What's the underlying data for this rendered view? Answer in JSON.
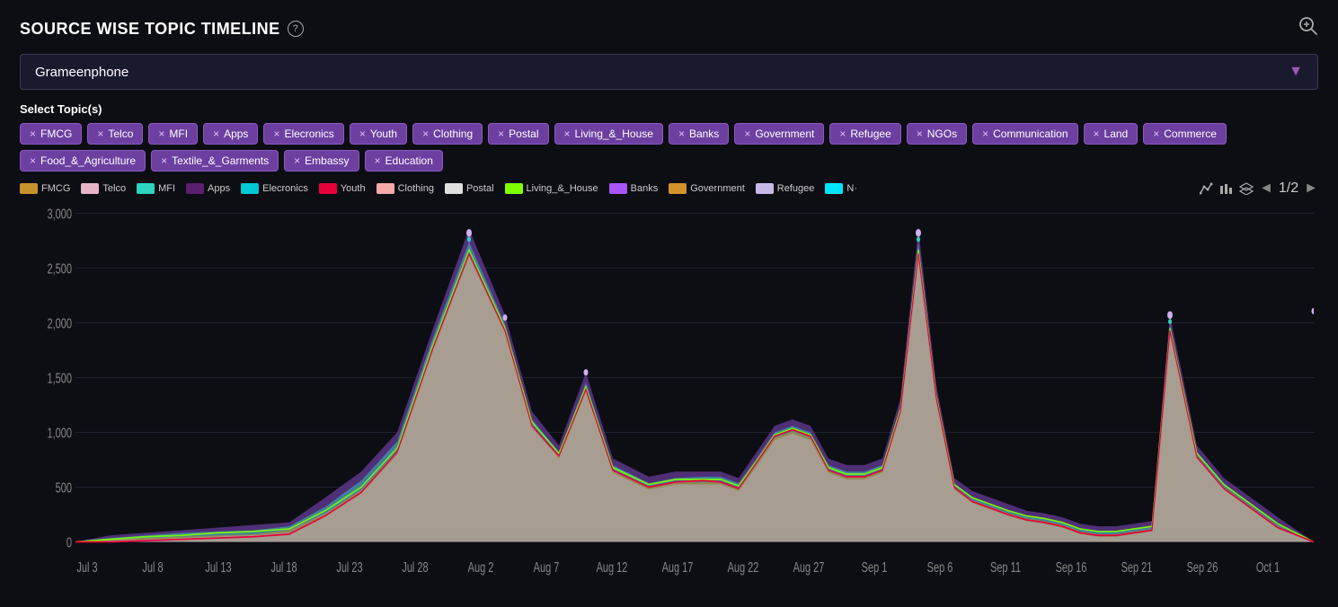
{
  "header": {
    "title": "SOURCE WISE TOPIC TIMELINE",
    "info_icon": "ⓘ",
    "zoom_icon": "⊕"
  },
  "dropdown": {
    "selected": "Grameenphone",
    "arrow": "▼"
  },
  "select_label": "Select Topic(s)",
  "topics_row1": [
    {
      "label": "FMCG"
    },
    {
      "label": "Telco"
    },
    {
      "label": "MFI"
    },
    {
      "label": "Apps"
    },
    {
      "label": "Elecronics"
    },
    {
      "label": "Youth"
    },
    {
      "label": "Clothing"
    },
    {
      "label": "Postal"
    },
    {
      "label": "Living_&_House"
    },
    {
      "label": "Banks"
    },
    {
      "label": "Government"
    },
    {
      "label": "Refugee"
    },
    {
      "label": "NGOs"
    }
  ],
  "topics_row2": [
    {
      "label": "Communication"
    },
    {
      "label": "Land"
    },
    {
      "label": "Commerce"
    },
    {
      "label": "Food_&_Agriculture"
    },
    {
      "label": "Textile_&_Garments"
    },
    {
      "label": "Embassy"
    },
    {
      "label": "Education"
    }
  ],
  "legend": {
    "items": [
      {
        "label": "FMCG",
        "color": "#c8922a"
      },
      {
        "label": "Telco",
        "color": "#e8b4c8"
      },
      {
        "label": "MFI",
        "color": "#2dd4bf"
      },
      {
        "label": "Apps",
        "color": "#5a1f6e"
      },
      {
        "label": "Elecronics",
        "color": "#00c8d4"
      },
      {
        "label": "Youth",
        "color": "#e8003a"
      },
      {
        "label": "Clothing",
        "color": "#f8a8a8"
      },
      {
        "label": "Postal",
        "color": "#e0e0e0"
      },
      {
        "label": "Living_&_House",
        "color": "#7fff00"
      },
      {
        "label": "Banks",
        "color": "#a855f7"
      },
      {
        "label": "Government",
        "color": "#d4922a"
      },
      {
        "label": "Refugee",
        "color": "#c8b8e8"
      },
      {
        "label": "N·",
        "color": "#00e5ff"
      }
    ],
    "page": "1/2"
  },
  "xaxis": [
    "Jul 3",
    "Jul 8",
    "Jul 13",
    "Jul 18",
    "Jul 23",
    "Jul 28",
    "Aug 2",
    "Aug 7",
    "Aug 12",
    "Aug 17",
    "Aug 22",
    "Aug 27",
    "Sep 1",
    "Sep 6",
    "Sep 11",
    "Sep 16",
    "Sep 21",
    "Sep 26",
    "Oct 1"
  ],
  "yaxis": [
    "3,000",
    "2,500",
    "2,000",
    "1,500",
    "1,000",
    "500",
    "0"
  ],
  "colors": {
    "background": "#0d0d14",
    "accent": "#6c3fa0",
    "border": "#3a3a5a"
  }
}
